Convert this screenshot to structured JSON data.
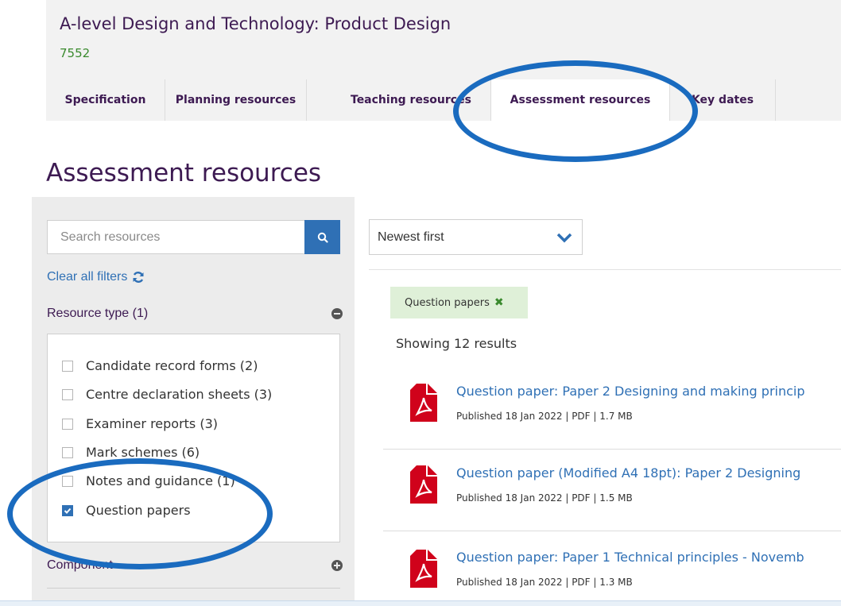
{
  "header": {
    "course_title": "A-level Design and Technology: Product Design",
    "course_code": "7552",
    "tabs": [
      {
        "label": "Specification"
      },
      {
        "label": "Planning resources"
      },
      {
        "label": "Teaching resources"
      },
      {
        "label": "Assessment resources",
        "active": true
      },
      {
        "label": "Key dates"
      }
    ]
  },
  "page_title": "Assessment resources",
  "sidebar": {
    "search": {
      "placeholder": "Search resources",
      "icon": "search-icon"
    },
    "clear_filters_label": "Clear all filters",
    "resource_type_heading": "Resource type (1)",
    "resource_type_options": [
      {
        "label": "Candidate record forms (2)",
        "checked": false
      },
      {
        "label": "Centre declaration sheets (3)",
        "checked": false
      },
      {
        "label": "Examiner reports (3)",
        "checked": false
      },
      {
        "label": "Mark schemes (6)",
        "checked": false
      },
      {
        "label": "Notes and guidance (1)",
        "checked": false
      },
      {
        "label": "Question papers",
        "checked": true
      }
    ],
    "component_heading": "Component"
  },
  "results": {
    "sort_value": "Newest first",
    "active_filter_tag": "Question papers",
    "count_text": "Showing 12 results",
    "items": [
      {
        "title": "Question paper: Paper 2 Designing and making princip",
        "meta": "Published 18 Jan 2022 | PDF | 1.7 MB"
      },
      {
        "title": "Question paper (Modified A4 18pt): Paper 2 Designing",
        "meta": "Published 18 Jan 2022 | PDF | 1.5 MB"
      },
      {
        "title": "Question paper: Paper 1 Technical principles - Novemb",
        "meta": "Published 18 Jan 2022 | PDF | 1.3 MB"
      }
    ]
  },
  "colors": {
    "brand_purple": "#3d1a52",
    "link_blue": "#2f70b5",
    "code_green": "#3a8a2e",
    "pdf_red": "#d0021b",
    "annotation_blue": "#1a6bbf"
  }
}
